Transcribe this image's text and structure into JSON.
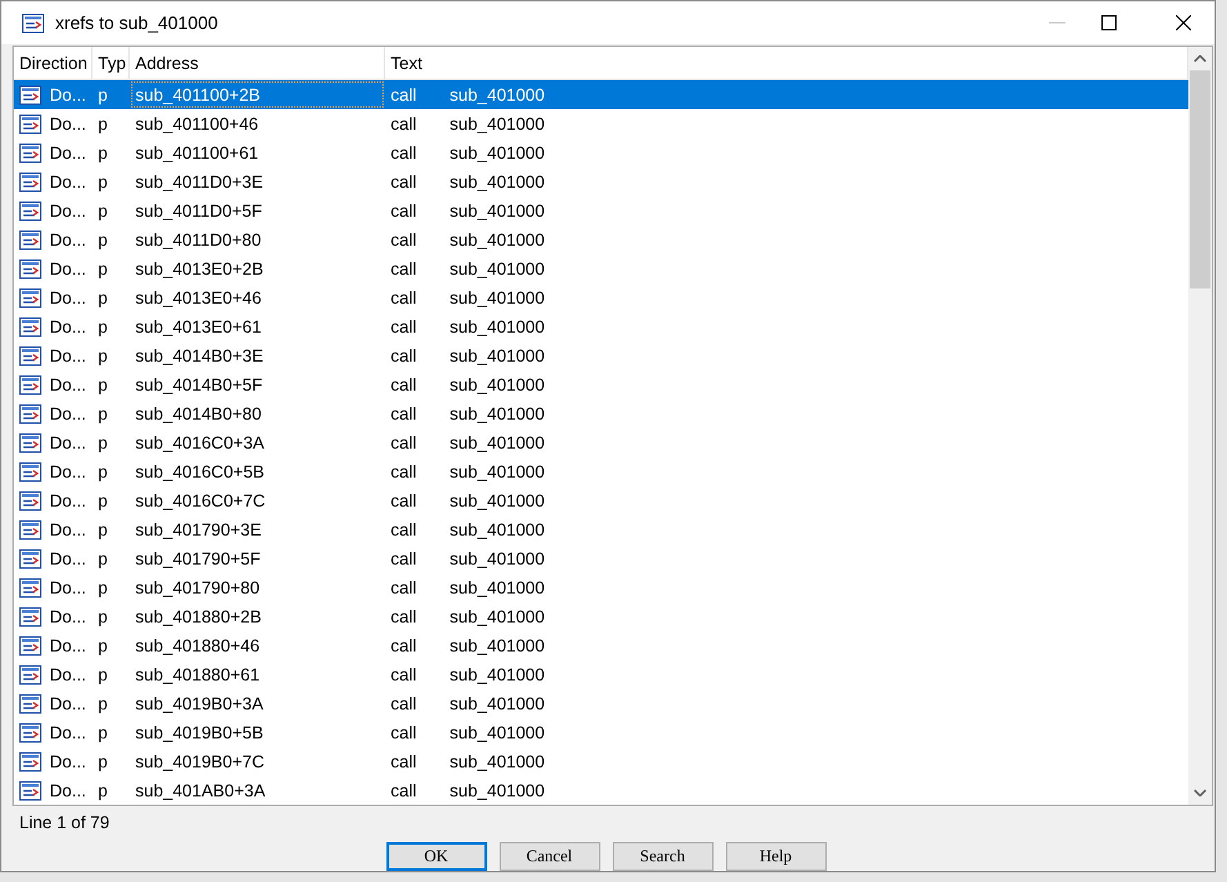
{
  "window": {
    "title": "xrefs to sub_401000"
  },
  "table": {
    "columns": [
      "Direction",
      "Typ",
      "Address",
      "Text"
    ],
    "rows": [
      {
        "direction": "Do...",
        "type": "p",
        "address": "sub_401100+2B",
        "op": "call",
        "arg": "sub_401000",
        "selected": true
      },
      {
        "direction": "Do...",
        "type": "p",
        "address": "sub_401100+46",
        "op": "call",
        "arg": "sub_401000",
        "selected": false
      },
      {
        "direction": "Do...",
        "type": "p",
        "address": "sub_401100+61",
        "op": "call",
        "arg": "sub_401000",
        "selected": false
      },
      {
        "direction": "Do...",
        "type": "p",
        "address": "sub_4011D0+3E",
        "op": "call",
        "arg": "sub_401000",
        "selected": false
      },
      {
        "direction": "Do...",
        "type": "p",
        "address": "sub_4011D0+5F",
        "op": "call",
        "arg": "sub_401000",
        "selected": false
      },
      {
        "direction": "Do...",
        "type": "p",
        "address": "sub_4011D0+80",
        "op": "call",
        "arg": "sub_401000",
        "selected": false
      },
      {
        "direction": "Do...",
        "type": "p",
        "address": "sub_4013E0+2B",
        "op": "call",
        "arg": "sub_401000",
        "selected": false
      },
      {
        "direction": "Do...",
        "type": "p",
        "address": "sub_4013E0+46",
        "op": "call",
        "arg": "sub_401000",
        "selected": false
      },
      {
        "direction": "Do...",
        "type": "p",
        "address": "sub_4013E0+61",
        "op": "call",
        "arg": "sub_401000",
        "selected": false
      },
      {
        "direction": "Do...",
        "type": "p",
        "address": "sub_4014B0+3E",
        "op": "call",
        "arg": "sub_401000",
        "selected": false
      },
      {
        "direction": "Do...",
        "type": "p",
        "address": "sub_4014B0+5F",
        "op": "call",
        "arg": "sub_401000",
        "selected": false
      },
      {
        "direction": "Do...",
        "type": "p",
        "address": "sub_4014B0+80",
        "op": "call",
        "arg": "sub_401000",
        "selected": false
      },
      {
        "direction": "Do...",
        "type": "p",
        "address": "sub_4016C0+3A",
        "op": "call",
        "arg": "sub_401000",
        "selected": false
      },
      {
        "direction": "Do...",
        "type": "p",
        "address": "sub_4016C0+5B",
        "op": "call",
        "arg": "sub_401000",
        "selected": false
      },
      {
        "direction": "Do...",
        "type": "p",
        "address": "sub_4016C0+7C",
        "op": "call",
        "arg": "sub_401000",
        "selected": false
      },
      {
        "direction": "Do...",
        "type": "p",
        "address": "sub_401790+3E",
        "op": "call",
        "arg": "sub_401000",
        "selected": false
      },
      {
        "direction": "Do...",
        "type": "p",
        "address": "sub_401790+5F",
        "op": "call",
        "arg": "sub_401000",
        "selected": false
      },
      {
        "direction": "Do...",
        "type": "p",
        "address": "sub_401790+80",
        "op": "call",
        "arg": "sub_401000",
        "selected": false
      },
      {
        "direction": "Do...",
        "type": "p",
        "address": "sub_401880+2B",
        "op": "call",
        "arg": "sub_401000",
        "selected": false
      },
      {
        "direction": "Do...",
        "type": "p",
        "address": "sub_401880+46",
        "op": "call",
        "arg": "sub_401000",
        "selected": false
      },
      {
        "direction": "Do...",
        "type": "p",
        "address": "sub_401880+61",
        "op": "call",
        "arg": "sub_401000",
        "selected": false
      },
      {
        "direction": "Do...",
        "type": "p",
        "address": "sub_4019B0+3A",
        "op": "call",
        "arg": "sub_401000",
        "selected": false
      },
      {
        "direction": "Do...",
        "type": "p",
        "address": "sub_4019B0+5B",
        "op": "call",
        "arg": "sub_401000",
        "selected": false
      },
      {
        "direction": "Do...",
        "type": "p",
        "address": "sub_4019B0+7C",
        "op": "call",
        "arg": "sub_401000",
        "selected": false
      },
      {
        "direction": "Do...",
        "type": "p",
        "address": "sub_401AB0+3A",
        "op": "call",
        "arg": "sub_401000",
        "selected": false
      }
    ]
  },
  "status_bar": "Line 1 of 79",
  "buttons": [
    {
      "label": "OK",
      "kind": "default"
    },
    {
      "label": "Cancel",
      "kind": "normal"
    },
    {
      "label": "Search",
      "kind": "normal"
    },
    {
      "label": "Help",
      "kind": "normal"
    }
  ]
}
